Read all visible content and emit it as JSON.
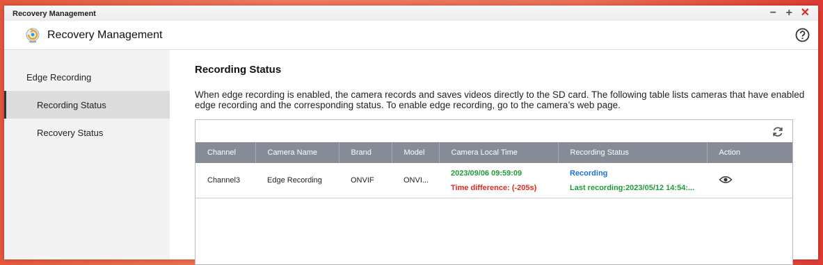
{
  "window": {
    "title": "Recovery Management",
    "controls": {
      "minimize": "−",
      "maximize": "+",
      "close": "✕"
    }
  },
  "app": {
    "title": "Recovery Management",
    "icon": "recovery-app-icon",
    "help_icon": "help-icon"
  },
  "sidebar": {
    "items": [
      {
        "label": "Edge Recording",
        "active": false
      },
      {
        "label": "Recording Status",
        "active": true
      },
      {
        "label": "Recovery Status",
        "active": false
      }
    ]
  },
  "main": {
    "heading": "Recording Status",
    "description": "When edge recording is enabled, the camera records and saves videos directly to the SD card. The following table lists cameras that have enabled edge recording and the corresponding status. To enable edge recording, go to the camera’s web page.",
    "refresh_icon": "refresh-icon",
    "table": {
      "columns": [
        "Channel",
        "Camera Name",
        "Brand",
        "Model",
        "Camera Local Time",
        "Recording Status",
        "Action"
      ],
      "rows": [
        {
          "channel": "Channel3",
          "camera_name": "Edge Recording",
          "brand": "ONVIF",
          "model": "ONVI...",
          "local_time": "2023/09/06 09:59:09",
          "time_difference": "Time difference: (-205s)",
          "status": "Recording",
          "last_recording": "Last recording:2023/05/12 14:54:...",
          "action_icon": "eye-icon"
        }
      ]
    }
  },
  "colors": {
    "green": "#1f9a3a",
    "red": "#e0281c",
    "blue": "#1a6fd8",
    "header_bg": "#868b98",
    "accent_close": "#e0281c"
  }
}
